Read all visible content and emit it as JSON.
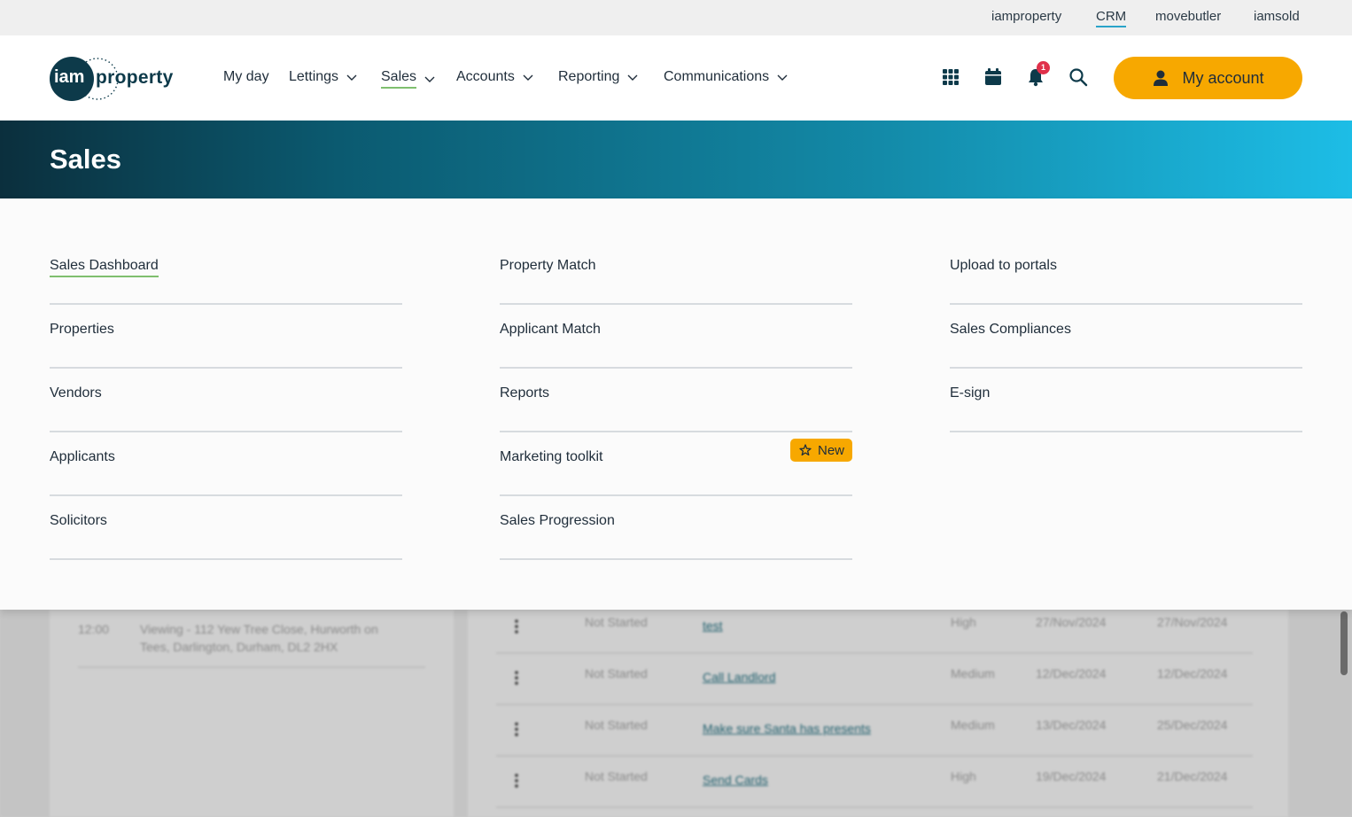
{
  "topbar": {
    "links": [
      {
        "label": "iamproperty",
        "active": false
      },
      {
        "label": "CRM",
        "active": true
      },
      {
        "label": "movebutler",
        "active": false
      },
      {
        "label": "iamsold",
        "active": false
      }
    ]
  },
  "header": {
    "logo": {
      "mark": "iam",
      "word": "property"
    },
    "nav": [
      {
        "label": "My day",
        "has_dropdown": false
      },
      {
        "label": "Lettings",
        "has_dropdown": true
      },
      {
        "label": "Sales",
        "has_dropdown": true,
        "active": true
      },
      {
        "label": "Accounts",
        "has_dropdown": true
      },
      {
        "label": "Reporting",
        "has_dropdown": true
      },
      {
        "label": "Communications",
        "has_dropdown": true
      }
    ],
    "icons": [
      "apps-grid-icon",
      "calendar-icon",
      "bell-icon",
      "search-icon"
    ],
    "notification_count": "1",
    "account_label": "My account"
  },
  "banner": {
    "title": "Sales"
  },
  "menu": {
    "columns": [
      [
        {
          "label": "Sales Dashboard",
          "active": true
        },
        {
          "label": "Properties"
        },
        {
          "label": "Vendors"
        },
        {
          "label": "Applicants"
        },
        {
          "label": "Solicitors"
        }
      ],
      [
        {
          "label": "Property Match"
        },
        {
          "label": "Applicant Match"
        },
        {
          "label": "Reports"
        },
        {
          "label": "Marketing toolkit",
          "badge": "New"
        },
        {
          "label": "Sales Progression"
        }
      ],
      [
        {
          "label": "Upload to portals"
        },
        {
          "label": "Sales Compliances"
        },
        {
          "label": "E-sign"
        }
      ]
    ]
  },
  "background": {
    "events": [
      {
        "time": "12:00",
        "line1": "Viewing - 112 Yew Tree Close, Hurworth on",
        "line2": "Tees, Darlington, Durham, DL2 2HX"
      }
    ],
    "tasks": [
      {
        "status": "Not Started",
        "title": "test",
        "priority": "High",
        "start": "27/Nov/2024",
        "due": "27/Nov/2024"
      },
      {
        "status": "Not Started",
        "title": "Call Landlord",
        "priority": "Medium",
        "start": "12/Dec/2024",
        "due": "12/Dec/2024"
      },
      {
        "status": "Not Started",
        "title": "Make sure Santa has presents",
        "priority": "Medium",
        "start": "13/Dec/2024",
        "due": "25/Dec/2024"
      },
      {
        "status": "Not Started",
        "title": "Send Cards",
        "priority": "High",
        "start": "19/Dec/2024",
        "due": "21/Dec/2024"
      }
    ]
  },
  "colors": {
    "accent": "#f7a800",
    "brand_dark": "#0d3a4a",
    "active_underline": "#7fbf6e",
    "badge_red": "#e0304a"
  }
}
